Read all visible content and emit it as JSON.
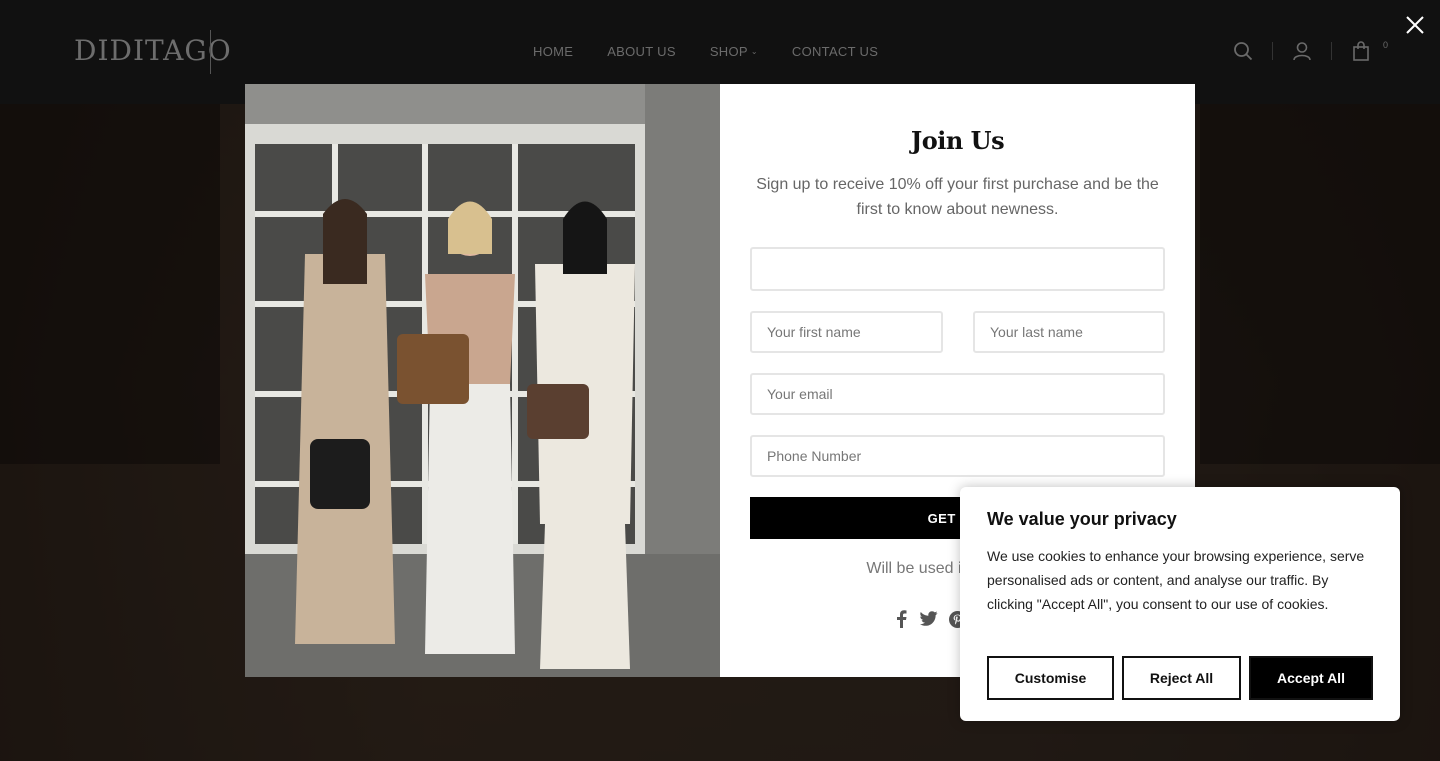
{
  "header": {
    "logo": "DIDITAGO",
    "nav": [
      {
        "label": "HOME"
      },
      {
        "label": "ABOUT US"
      },
      {
        "label": "SHOP",
        "has_dropdown": true
      },
      {
        "label": "CONTACT US"
      }
    ],
    "cart_count": "0",
    "icons": [
      "search-icon",
      "account-icon",
      "cart-icon"
    ]
  },
  "popup": {
    "title": "Join Us",
    "subtitle": "Sign up to receive 10% off your first purchase and be the first to know about newness.",
    "fields": {
      "top_value": "",
      "first_name_placeholder": "Your first name",
      "last_name_placeholder": "Your last name",
      "email_placeholder": "Your email",
      "phone_placeholder": "Phone Number"
    },
    "submit_label": "GET 10%",
    "note": "Will be used in accordanc",
    "social": [
      "facebook-icon",
      "twitter-icon",
      "pinterest-icon"
    ],
    "close_icon": "close-icon"
  },
  "cookie": {
    "title": "We value your privacy",
    "text": "We use cookies to enhance your browsing experience, serve personalised ads or content, and analyse our traffic. By clicking \"Accept All\", you consent to our use of cookies.",
    "customise_label": "Customise",
    "reject_label": "Reject All",
    "accept_label": "Accept All"
  },
  "colors": {
    "header_bg": "#111111",
    "button_bg": "#000000",
    "text_muted": "#666666"
  }
}
